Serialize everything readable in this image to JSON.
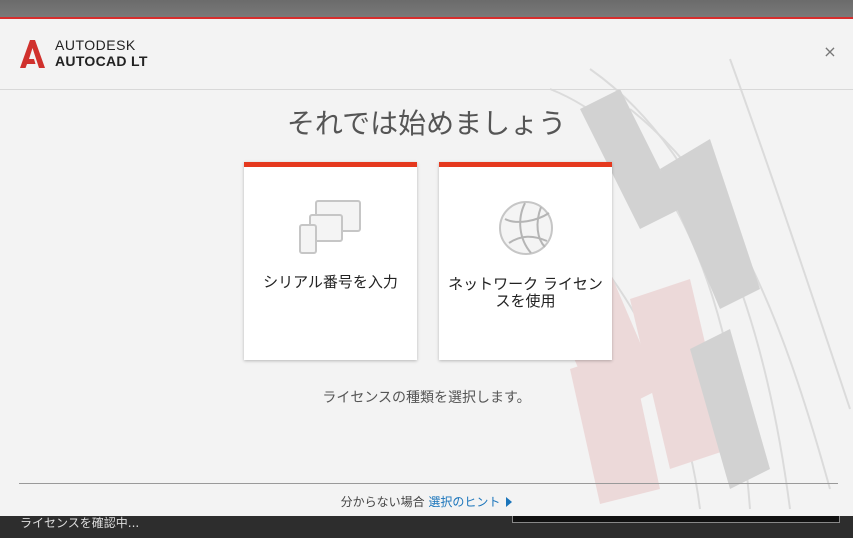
{
  "header": {
    "brand_company": "AUTODESK",
    "brand_product": "AUTOCAD LT",
    "close_glyph": "×"
  },
  "main": {
    "title": "それでは始めましょう",
    "cards": [
      {
        "label": "シリアル番号を入力",
        "icon": "devices-icon"
      },
      {
        "label": "ネットワーク ライセンスを使用",
        "icon": "globe-network-icon"
      }
    ],
    "description": "ライセンスの種類を選択します。"
  },
  "footer": {
    "prefix": "分からない場合",
    "link_label": "選択のヒント"
  },
  "statusbar": {
    "text": "ライセンスを確認中..."
  },
  "colors": {
    "accent": "#e5391e",
    "link": "#1b75bb",
    "top_redline": "#d62e2e"
  }
}
